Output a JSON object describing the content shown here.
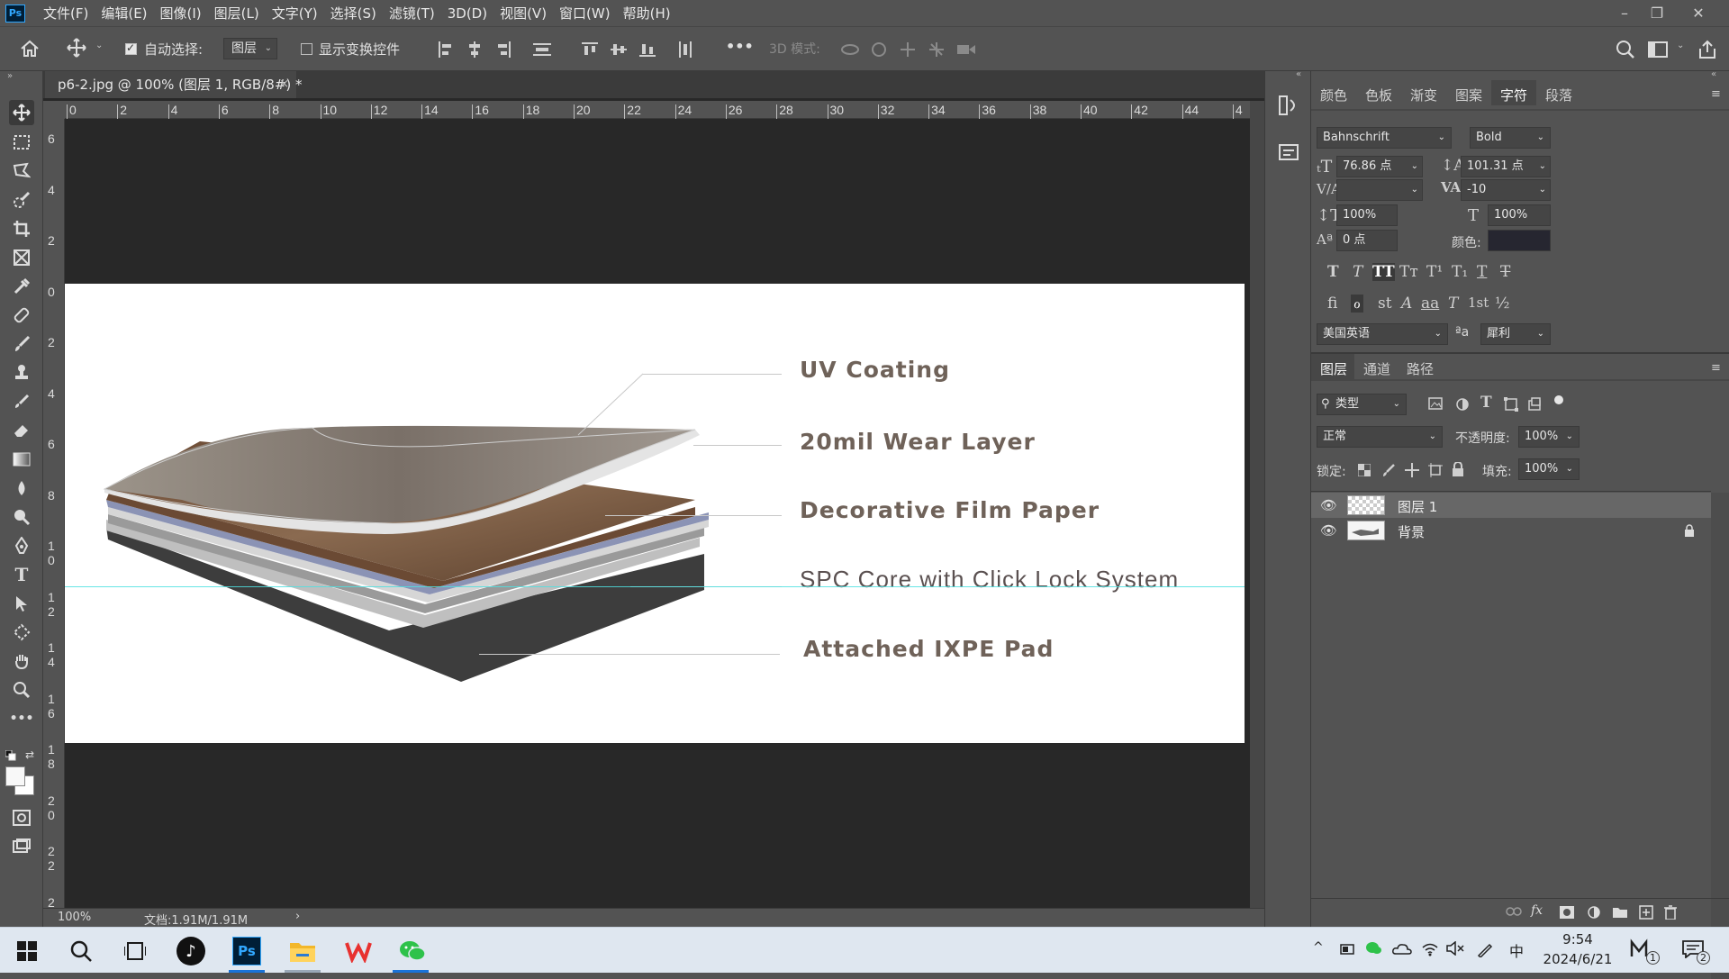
{
  "app": {
    "name": "Photoshop",
    "logo_text": "Ps"
  },
  "menu": {
    "items": [
      "文件(F)",
      "编辑(E)",
      "图像(I)",
      "图层(L)",
      "文字(Y)",
      "选择(S)",
      "滤镜(T)",
      "3D(D)",
      "视图(V)",
      "窗口(W)",
      "帮助(H)"
    ]
  },
  "window_controls": {
    "minimize": "–",
    "restore": "❐",
    "close": "✕"
  },
  "options_bar": {
    "auto_select_label": "自动选择:",
    "auto_select_checked": true,
    "auto_select_target": "图层",
    "show_transform_label": "显示变换控件",
    "show_transform_checked": false,
    "mode_3d_label": "3D 模式:",
    "more_label": "•••"
  },
  "document": {
    "tab_title": "p6-2.jpg @ 100% (图层 1, RGB/8#) *",
    "close_glyph": "×",
    "zoom": "100%",
    "doc_info": "文档:1.91M/1.91M",
    "status_arrow": "›"
  },
  "rulers": {
    "horizontal": [
      "0",
      "2",
      "4",
      "6",
      "8",
      "10",
      "12",
      "14",
      "16",
      "18",
      "20",
      "22",
      "24",
      "26",
      "28",
      "30",
      "32",
      "34",
      "36",
      "38",
      "40",
      "42",
      "44",
      "4"
    ],
    "vertical": [
      "6",
      "4",
      "2",
      "0",
      "2",
      "4",
      "6",
      "8",
      "1\n0",
      "1\n2",
      "1\n4",
      "1\n6",
      "1\n8",
      "2\n0",
      "2\n2",
      "2"
    ]
  },
  "artwork": {
    "labels": {
      "uv": "UV Coating",
      "wear": "20mil Wear Layer",
      "film": "Decorative Film Paper",
      "core": "SPC Core with Click Lock System",
      "pad": "Attached IXPE Pad"
    },
    "label_color": "#6f6259"
  },
  "panels": {
    "top_tabs": [
      "颜色",
      "色板",
      "渐变",
      "图案",
      "字符",
      "段落"
    ],
    "active_top_tab": "字符",
    "character": {
      "font_family": "Bahnschrift",
      "font_style": "Bold",
      "font_size": "76.86 点",
      "leading": "101.31 点",
      "kerning": "",
      "tracking": "-10",
      "vertical_scale": "100%",
      "horizontal_scale": "100%",
      "baseline_shift": "0 点",
      "color_label": "颜色:",
      "color_value": "#262630",
      "style_glyphs": [
        "T",
        "T",
        "TT",
        "Tт",
        "T¹",
        "T₁",
        "T",
        "T"
      ],
      "opentype_glyphs": [
        "fi",
        "ℴ",
        "st",
        "A",
        "aa",
        "T",
        "1st",
        "½"
      ],
      "language": "美国英语",
      "aa_icon": "ªa",
      "antialias": "犀利"
    },
    "layers_tabs": [
      "图层",
      "通道",
      "路径"
    ],
    "active_layers_tab": "图层",
    "layers": {
      "filter_kind": "类型",
      "blend_mode": "正常",
      "opacity_label": "不透明度:",
      "opacity": "100%",
      "lock_label": "锁定:",
      "fill_label": "填充:",
      "fill": "100%",
      "items": [
        {
          "name": "图层 1",
          "visible": true,
          "selected": true,
          "locked": false
        },
        {
          "name": "背景",
          "visible": true,
          "selected": false,
          "locked": true
        }
      ],
      "footer_icons": [
        "link-icon",
        "fx-icon",
        "mask-icon",
        "adjustment-icon",
        "group-icon",
        "new-layer-icon",
        "trash-icon"
      ],
      "fx_label": "fx"
    }
  },
  "taskbar": {
    "apps": [
      "start",
      "search",
      "task-view",
      "tiktok",
      "photoshop",
      "file-explorer",
      "wps",
      "wechat"
    ],
    "ps_label": "Ps",
    "time": "9:54",
    "date": "2024/6/21",
    "ime": "中",
    "notification_count": "2",
    "m_badge": "1"
  }
}
